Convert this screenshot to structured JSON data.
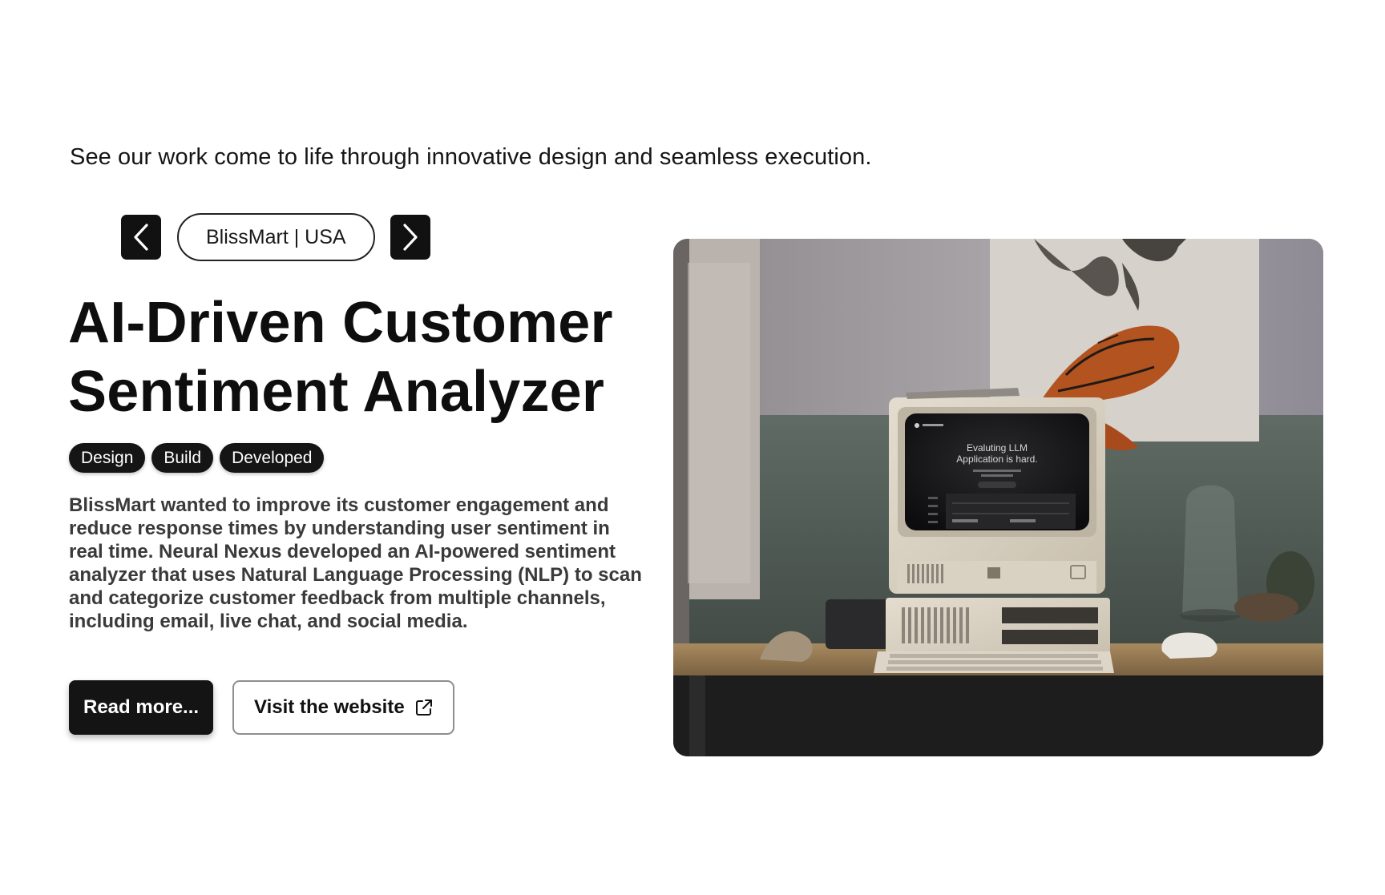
{
  "intro_text": "See our work come to life through innovative design and seamless execution.",
  "carousel": {
    "client_label": "BlissMart | USA",
    "prev_icon": "chevron-left-icon",
    "next_icon": "chevron-right-icon"
  },
  "project": {
    "title_line1": "AI-Driven Customer",
    "title_line2": "Sentiment Analyzer",
    "tags": [
      "Design",
      "Build",
      "Developed"
    ],
    "description": "BlissMart wanted to improve its customer engagement and reduce response times by understanding user sentiment in real time. Neural Nexus developed an AI-powered sentiment analyzer that uses Natural Language Processing (NLP) to scan and categorize customer feedback from multiple channels, including email, live chat, and social media."
  },
  "actions": {
    "read_more_label": "Read more...",
    "visit_label": "Visit the website",
    "visit_icon": "external-link-icon"
  },
  "hero_image": {
    "screen_line1": "Evaluting LLM",
    "screen_line2": "Application is hard."
  },
  "colors": {
    "dark": "#111111",
    "white": "#ffffff",
    "text_body": "#3a3a3a",
    "border_gray": "#8e8e8e"
  }
}
